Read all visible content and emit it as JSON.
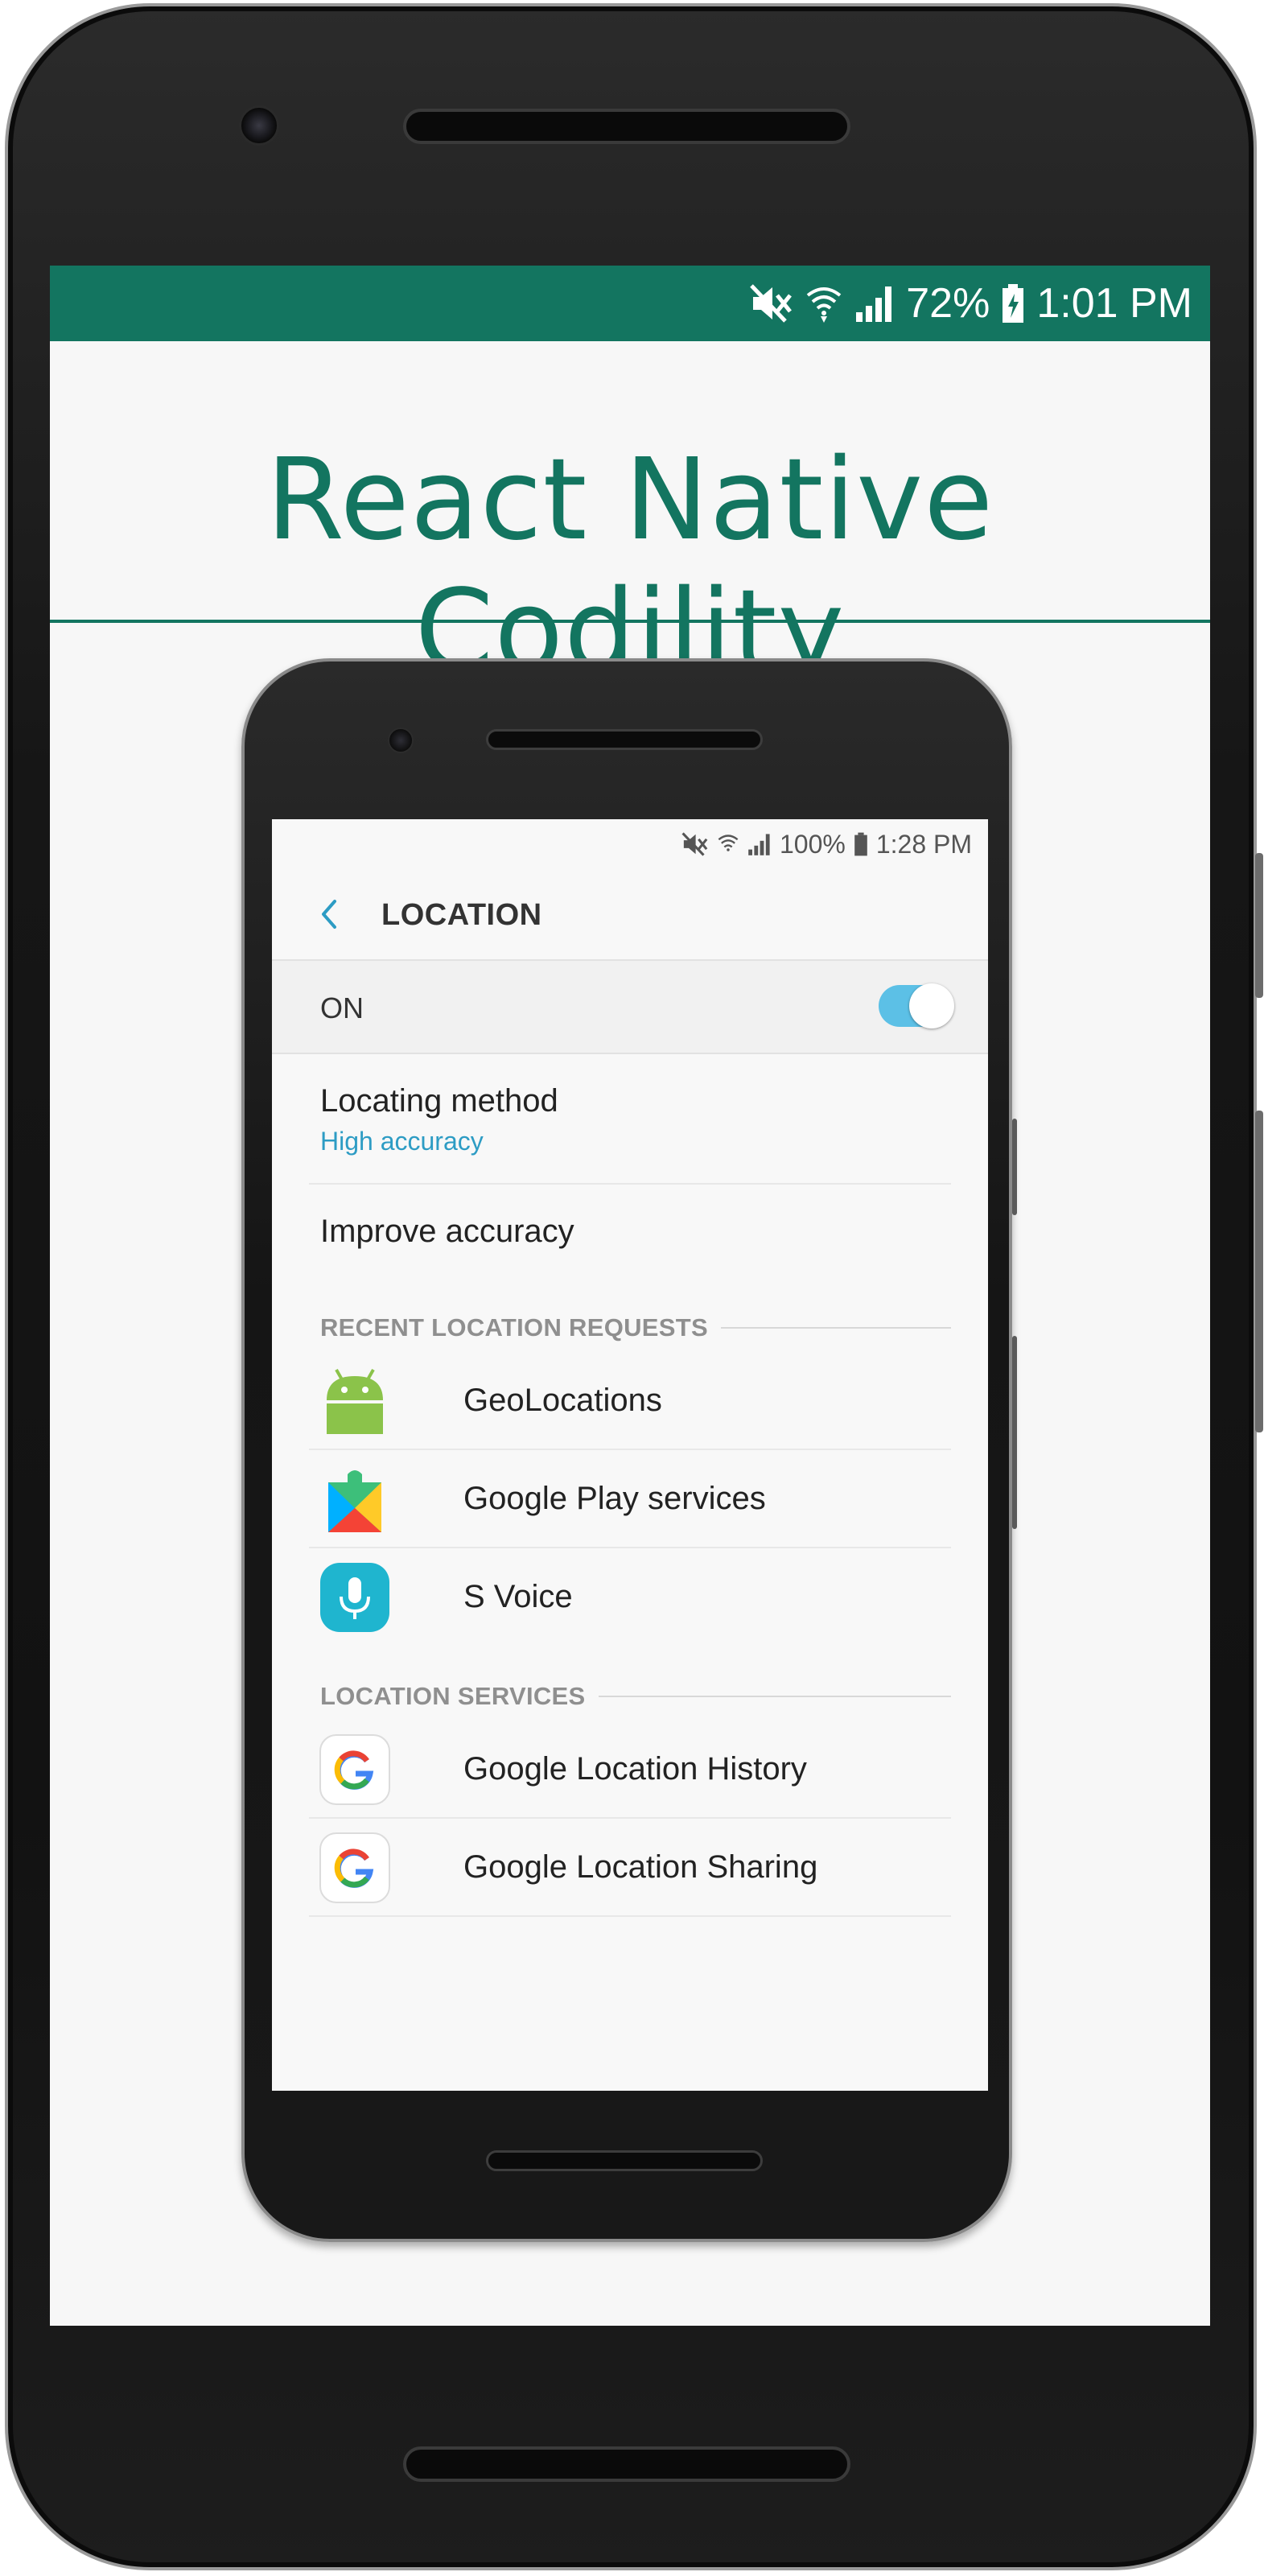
{
  "outer_status": {
    "battery_percent": "72%",
    "time": "1:01 PM",
    "icons": [
      "mute-icon",
      "wifi-icon",
      "signal-icon",
      "battery-icon"
    ]
  },
  "app": {
    "title": "React Native Codility"
  },
  "inner_status": {
    "battery_percent": "100%",
    "time": "1:28 PM",
    "icons": [
      "mute-icon",
      "wifi-icon",
      "signal-icon",
      "battery-icon"
    ]
  },
  "location_screen": {
    "header_title": "LOCATION",
    "toggle_label": "ON",
    "toggle_on": true,
    "locating_method": {
      "title": "Locating method",
      "value": "High accuracy"
    },
    "improve_accuracy": "Improve accuracy",
    "recent_requests_header": "RECENT LOCATION REQUESTS",
    "recent_requests": [
      {
        "label": "GeoLocations",
        "icon": "android-icon"
      },
      {
        "label": "Google Play services",
        "icon": "google-play-services-icon"
      },
      {
        "label": "S Voice",
        "icon": "s-voice-mic-icon"
      }
    ],
    "location_services_header": "LOCATION SERVICES",
    "location_services": [
      {
        "label": "Google Location History",
        "icon": "google-g-icon"
      },
      {
        "label": "Google Location Sharing",
        "icon": "google-g-icon"
      }
    ]
  },
  "colors": {
    "brand_green": "#137560",
    "accent_blue": "#2d9cc4",
    "toggle_blue": "#5cc0e6"
  }
}
